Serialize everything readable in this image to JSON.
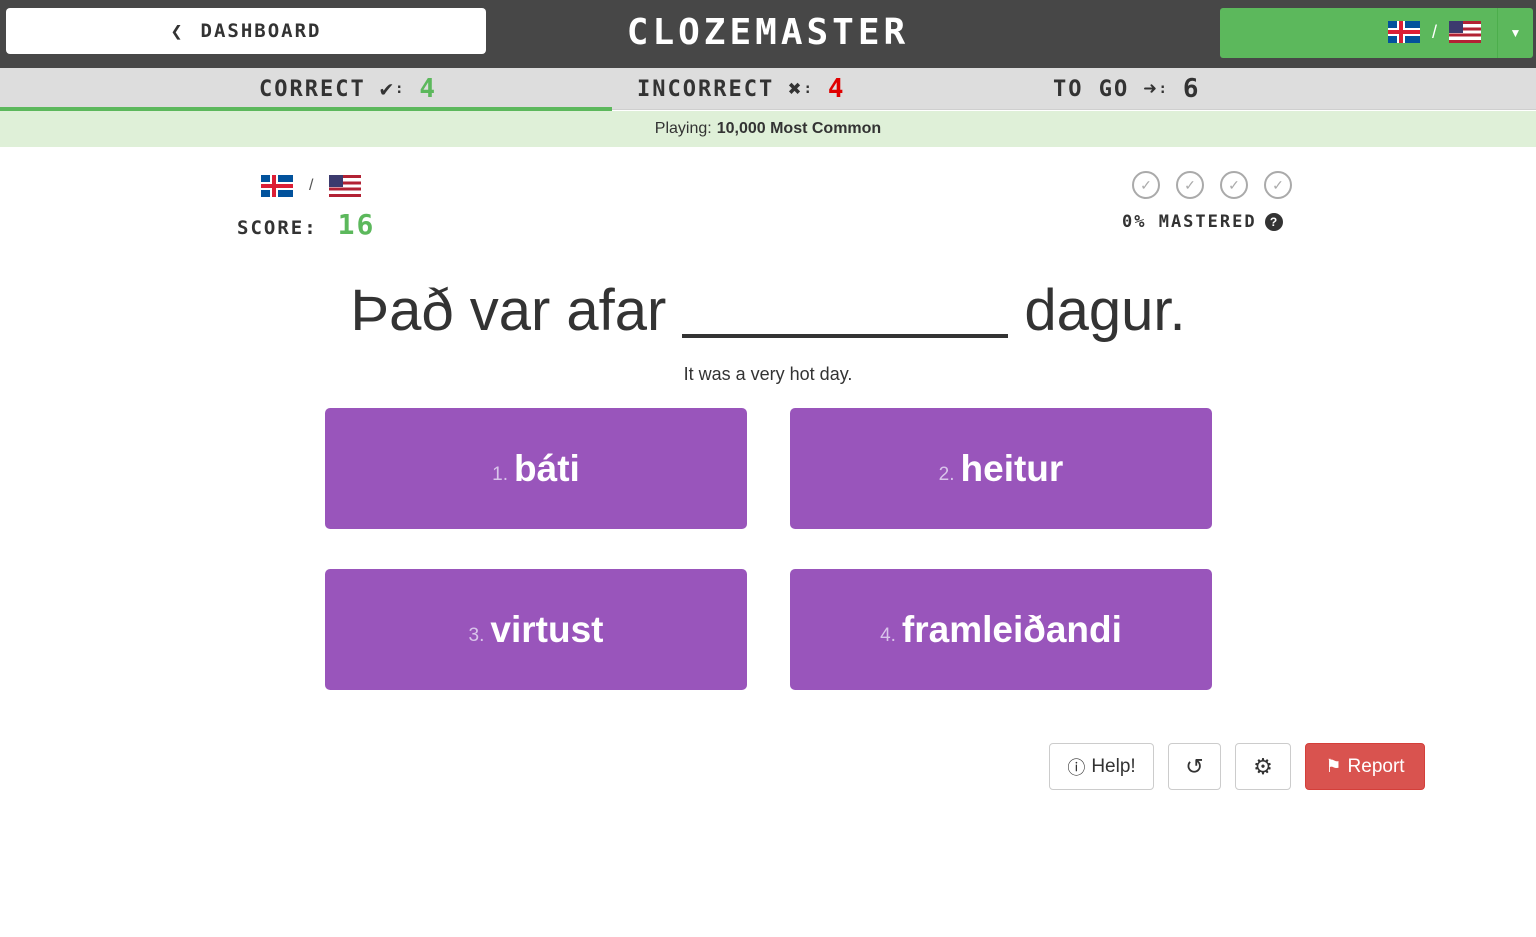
{
  "header": {
    "dashboard_label": "DASHBOARD",
    "logo": "CLOZEMASTER",
    "language_pair": {
      "from_flag": "iceland-flag",
      "to_flag": "usa-flag",
      "separator": "/"
    }
  },
  "stats": {
    "correct_label": "CORRECT",
    "correct_value": "4",
    "incorrect_label": "INCORRECT",
    "incorrect_value": "4",
    "to_go_label": "TO GO",
    "to_go_value": "6",
    "colon": ":"
  },
  "playing": {
    "label": "Playing:",
    "collection": "10,000 Most Common"
  },
  "score": {
    "label": "SCORE:",
    "value": "16"
  },
  "mastery": {
    "text": "0% MASTERED",
    "levels_shown": 4
  },
  "sentence": {
    "before": "Það var afar",
    "after": "dagur.",
    "translation": "It was a very hot day."
  },
  "choices": [
    {
      "number": "1.",
      "text": "báti"
    },
    {
      "number": "2.",
      "text": "heitur"
    },
    {
      "number": "3.",
      "text": "virtust"
    },
    {
      "number": "4.",
      "text": "framleiðandi"
    }
  ],
  "actions": {
    "help_label": "Help!",
    "report_label": "Report"
  },
  "colors": {
    "accent_green": "#5cb85c",
    "choice_purple": "#9955bb",
    "incorrect_red": "#e00000",
    "report_red": "#d9534f",
    "topbar": "#474747"
  }
}
